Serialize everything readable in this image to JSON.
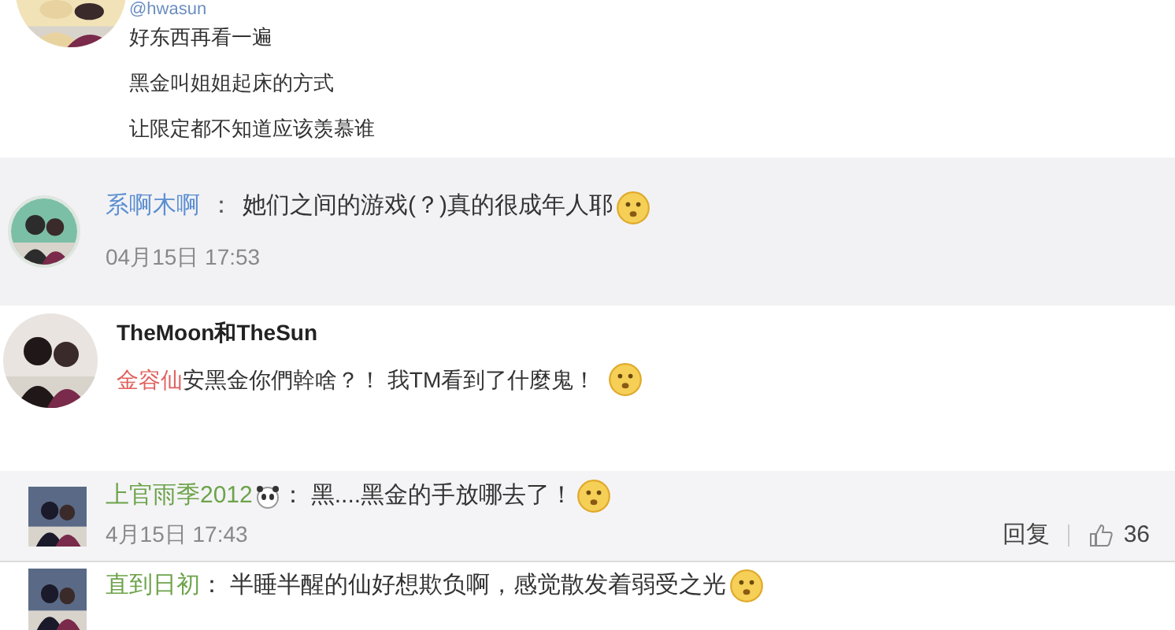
{
  "sections": [
    {
      "kind": "post",
      "handle": "@hwasun",
      "lines": [
        "好东西再看一遍",
        "黑金叫姐姐起床的方式",
        "让限定都不知道应该羡慕谁"
      ]
    },
    {
      "kind": "comment",
      "author": "系啊木啊",
      "separator": "：",
      "text": "她们之间的游戏(？)真的很成年人耶",
      "time": "04月15日 17:53"
    },
    {
      "kind": "mention_post",
      "author": "TheMoon和TheSun",
      "mention": "金容仙",
      "text": "安黑金你們幹啥？！ 我TM看到了什麼鬼！"
    },
    {
      "kind": "reply",
      "author": "上官雨季2012",
      "separator": "：",
      "text": "黑....黑金的手放哪去了！",
      "time": "4月15日 17:43",
      "reply_label": "回复",
      "likes": "36"
    },
    {
      "kind": "reply",
      "author": "直到日初",
      "separator": "：",
      "text": "半睡半醒的仙好想欺负啊，感觉散发着弱受之光"
    }
  ]
}
